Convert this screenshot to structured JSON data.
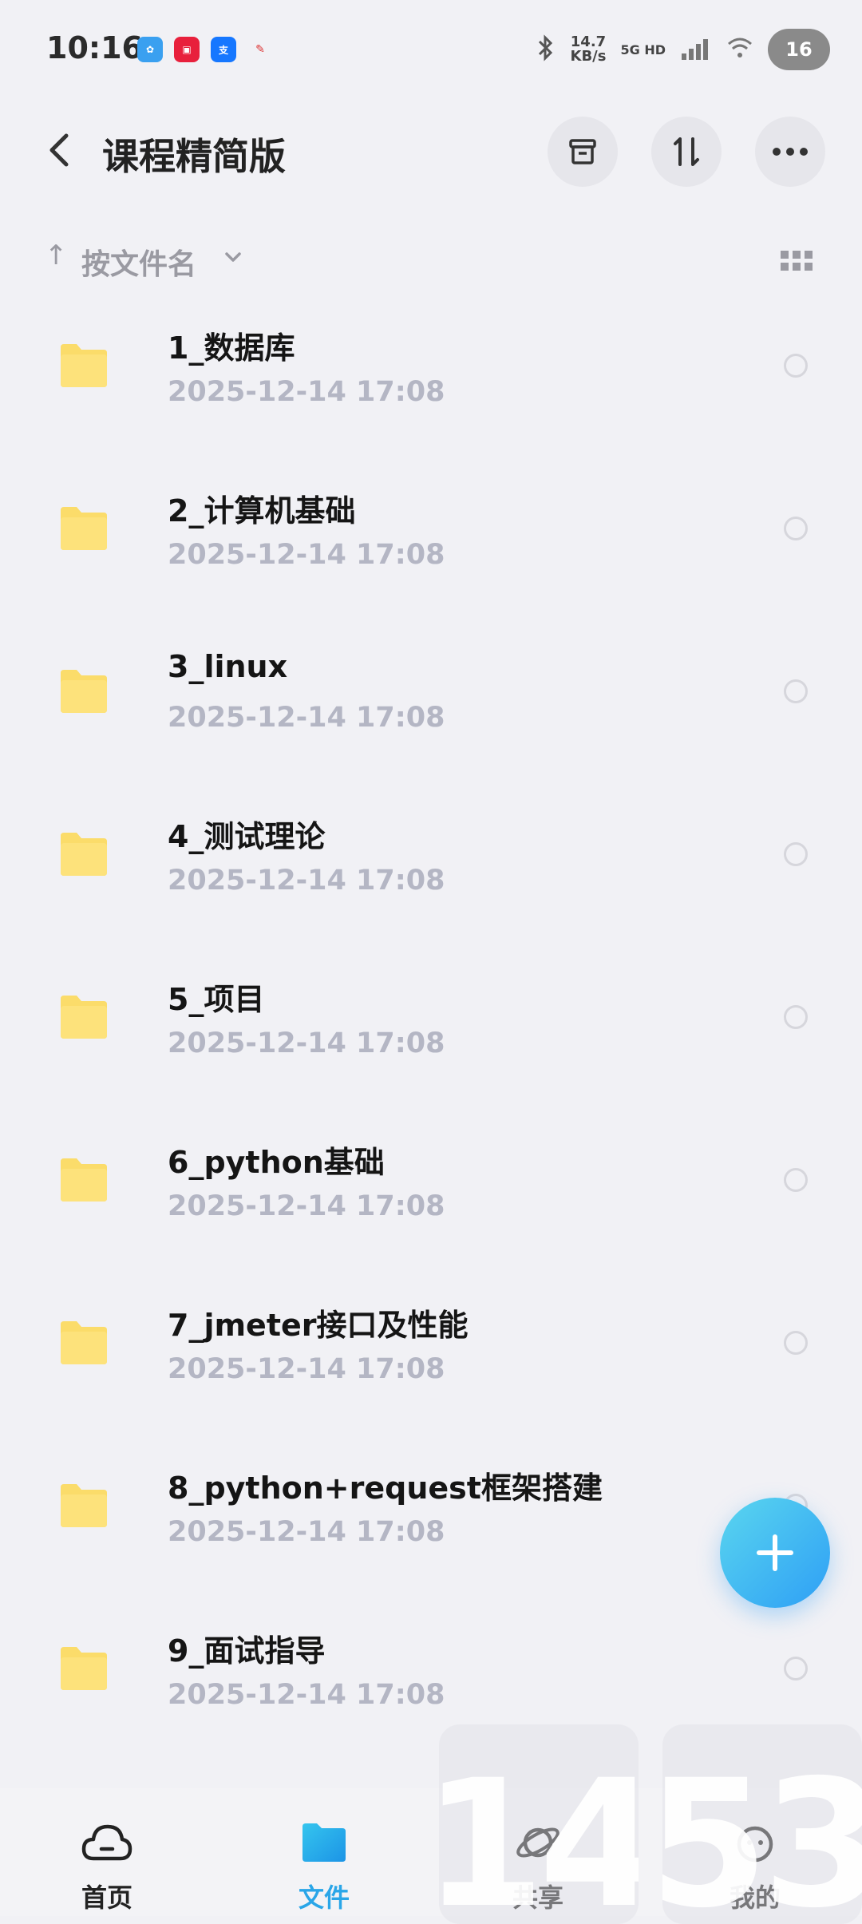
{
  "status_bar": {
    "time": "10:16",
    "speed_value": "14.7",
    "speed_unit": "KB/s",
    "network": "5G HD",
    "battery": "16"
  },
  "header": {
    "title": "课程精简版"
  },
  "sort": {
    "label": "按文件名"
  },
  "files": [
    {
      "name": "1_数据库",
      "date": "2025-12-14  17:08"
    },
    {
      "name": "2_计算机基础",
      "date": "2025-12-14  17:08"
    },
    {
      "name": "3_linux",
      "date": "2025-12-14  17:08"
    },
    {
      "name": "4_测试理论",
      "date": "2025-12-14  17:08"
    },
    {
      "name": "5_项目",
      "date": "2025-12-14  17:08"
    },
    {
      "name": "6_python基础",
      "date": "2025-12-14  17:08"
    },
    {
      "name": "7_jmeter接口及性能",
      "date": "2025-12-14  17:08"
    },
    {
      "name": "8_python+request框架搭建",
      "date": "2025-12-14  17:08"
    },
    {
      "name": "9_面试指导",
      "date": "2025-12-14  17:08"
    }
  ],
  "bottom_nav": [
    {
      "label": "首页",
      "icon": "cloud-icon",
      "active": false
    },
    {
      "label": "文件",
      "icon": "folder-icon",
      "active": true
    },
    {
      "label": "共享",
      "icon": "planet-icon",
      "active": false
    },
    {
      "label": "我的",
      "icon": "profile-icon",
      "active": false
    }
  ],
  "overlay_clock": {
    "hours": "14",
    "minutes": "53"
  },
  "colors": {
    "accent": "#2aa6e8",
    "folder": "#fbdc6a",
    "background": "#f1f1f5"
  }
}
